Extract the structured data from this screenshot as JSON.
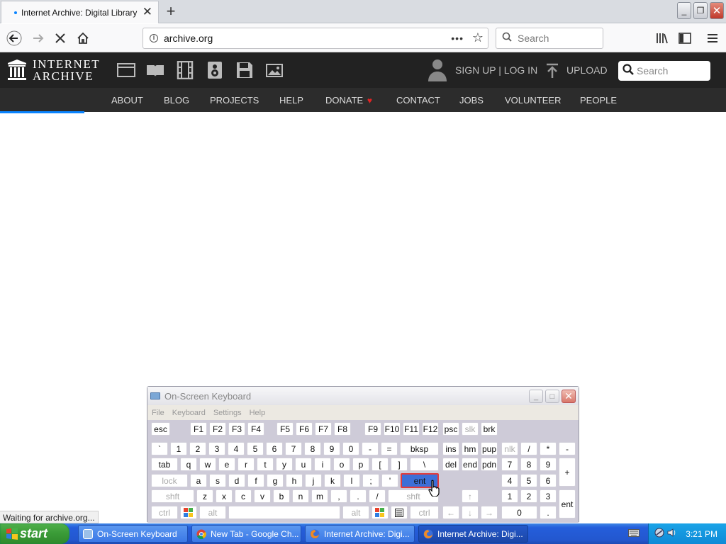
{
  "browser": {
    "tab_title": "Internet Archive: Digital Library of",
    "tab_close": "✕",
    "new_tab": "+",
    "window_controls": {
      "minimize": "_",
      "restore": "❐",
      "close": "✕"
    },
    "url": "archive.org",
    "search_placeholder": "Search",
    "status_text": "Waiting for archive.org..."
  },
  "archive": {
    "logo_line1": "INTERNET",
    "logo_line2": "ARCHIVE",
    "signup_login": "SIGN UP | LOG IN",
    "upload": "UPLOAD",
    "search_placeholder": "Search",
    "nav": [
      "ABOUT",
      "BLOG",
      "PROJECTS",
      "HELP",
      "DONATE",
      "CONTACT",
      "JOBS",
      "VOLUNTEER",
      "PEOPLE"
    ],
    "donate_heart": "♥",
    "colors": {
      "header_bg": "#222222",
      "subnav_bg": "#2c2c2c",
      "donate_heart": "#e02424"
    }
  },
  "osk": {
    "title": "On-Screen Keyboard",
    "menu": [
      "File",
      "Keyboard",
      "Settings",
      "Help"
    ],
    "keys": {
      "esc": "esc",
      "F1": "F1",
      "F2": "F2",
      "F3": "F3",
      "F4": "F4",
      "F5": "F5",
      "F6": "F6",
      "F7": "F7",
      "F8": "F8",
      "F9": "F9",
      "F10": "F10",
      "F11": "F11",
      "F12": "F12",
      "psc": "psc",
      "slk": "slk",
      "brk": "brk",
      "grave": "`",
      "d1": "1",
      "d2": "2",
      "d3": "3",
      "d4": "4",
      "d5": "5",
      "d6": "6",
      "d7": "7",
      "d8": "8",
      "d9": "9",
      "d0": "0",
      "minus": "-",
      "equals": "=",
      "bksp": "bksp",
      "ins": "ins",
      "hm": "hm",
      "pup": "pup",
      "nlk": "nlk",
      "kslash": "/",
      "kstar": "*",
      "kminus": "-",
      "tab": "tab",
      "q": "q",
      "w": "w",
      "e": "e",
      "r": "r",
      "t": "t",
      "y": "y",
      "u": "u",
      "i": "i",
      "o": "o",
      "p": "p",
      "lbr": "[",
      "rbr": "]",
      "bslash": "\\",
      "del": "del",
      "end": "end",
      "pdn": "pdn",
      "k7": "7",
      "k8": "8",
      "k9": "9",
      "kplus": "+",
      "lock": "lock",
      "a": "a",
      "s": "s",
      "d": "d",
      "f": "f",
      "g": "g",
      "h": "h",
      "j": "j",
      "k": "k",
      "l": "l",
      "semi": ";",
      "quote": "'",
      "ent": "ent",
      "k4": "4",
      "k5": "5",
      "k6": "6",
      "lshft": "shft",
      "z": "z",
      "x": "x",
      "c": "c",
      "v": "v",
      "b": "b",
      "n": "n",
      "m": "m",
      "comma": ",",
      "period": ".",
      "slash": "/",
      "rshft": "shft",
      "up": "↑",
      "k1": "1",
      "k2": "2",
      "k3": "3",
      "kent": "ent",
      "lctrl": "ctrl",
      "lalt": "alt",
      "space": "",
      "ralt": "alt",
      "rctrl": "ctrl",
      "left": "←",
      "down": "↓",
      "right": "→",
      "k0": "0",
      "kdot": "."
    }
  },
  "taskbar": {
    "start": "start",
    "items": [
      "On-Screen Keyboard",
      "New Tab - Google Ch...",
      "Internet Archive: Digi...",
      "Internet Archive: Digi..."
    ],
    "time": "3:21 PM"
  }
}
